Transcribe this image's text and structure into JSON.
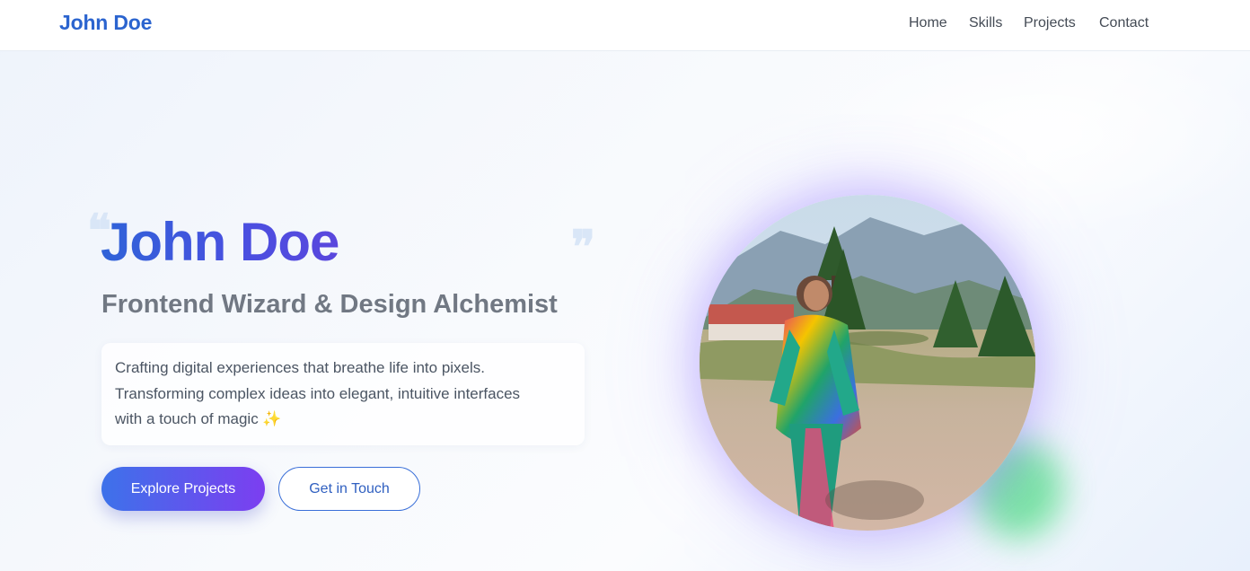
{
  "nav": {
    "brand": "John Doe",
    "links": [
      {
        "label": "Home"
      },
      {
        "label": "Skills"
      },
      {
        "label": "Projects"
      },
      {
        "label": "Contact"
      }
    ]
  },
  "hero": {
    "quote_open": "❝",
    "quote_close": "❞",
    "name": "John Doe",
    "subtitle": "Frontend Wizard & Design Alchemist",
    "description_lines": [
      "Crafting digital experiences that breathe life into pixels.",
      "Transforming complex ideas into elegant, intuitive interfaces",
      "with a touch of magic ✨"
    ],
    "primary_button": "Explore Projects",
    "secondary_button": "Get in Touch"
  },
  "profile_image": {
    "subject": "person in colorful scarf standing outdoors with mountains and trees"
  },
  "colors": {
    "brand": "#2b64cf",
    "gradient_start": "#3d72ea",
    "gradient_end": "#7c3ef0",
    "accent_green": "#4ade80"
  }
}
